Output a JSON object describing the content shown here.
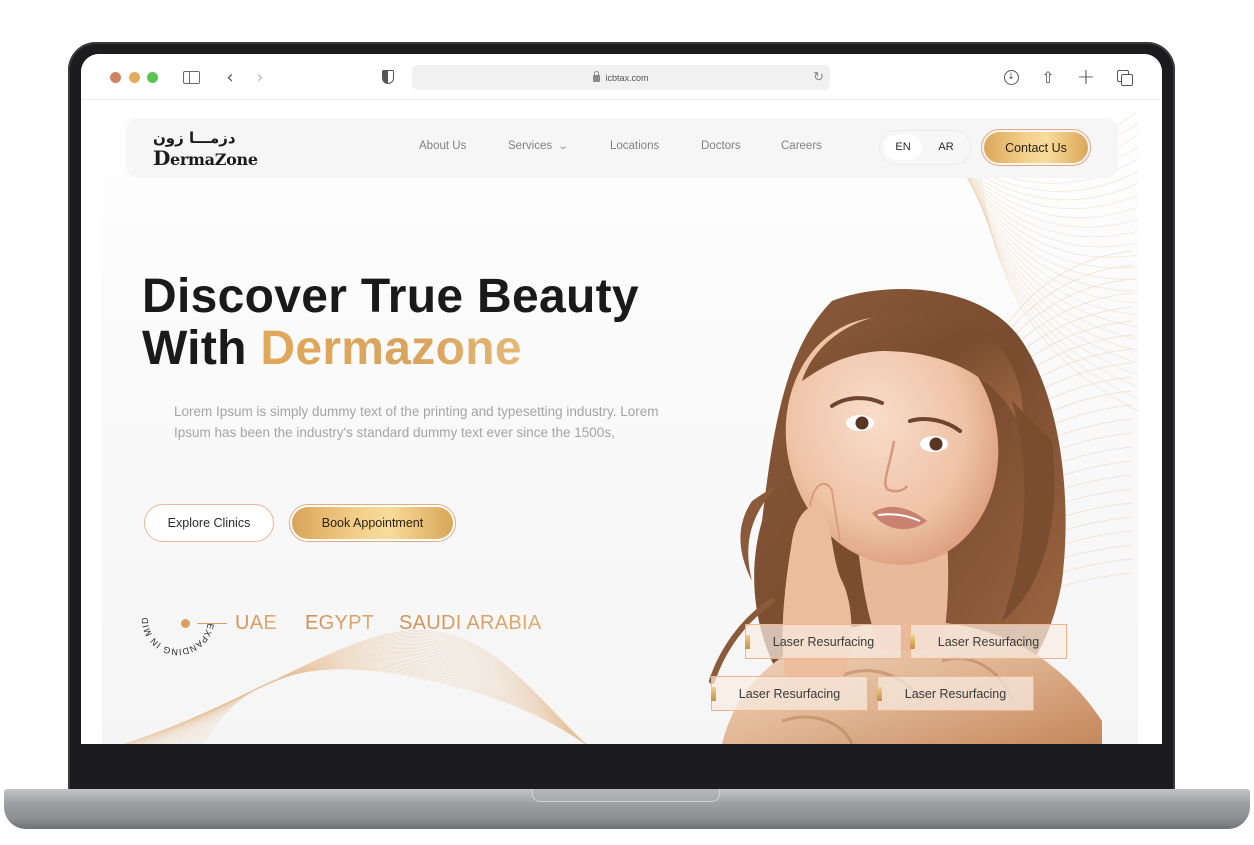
{
  "browser": {
    "url": "icbtax.com",
    "icons": {
      "sidebar": "sidebar-toggle-icon",
      "back": "chevron-left-icon",
      "forward": "chevron-right-icon",
      "privacy": "shield-icon",
      "lock": "lock-icon",
      "reload": "reload-icon",
      "downloads": "download-icon",
      "share": "share-icon",
      "new_tab": "plus-icon",
      "tabs": "tab-overview-icon"
    },
    "glyphs": {
      "back": "‹",
      "forward": "›",
      "reload": "↻",
      "download": "↓",
      "share": "⇧",
      "plus": "+"
    }
  },
  "site": {
    "logo": {
      "arabic": "دزمـــا زون",
      "english_initial": "D",
      "english_rest": "ermaZone"
    },
    "nav": {
      "items": [
        {
          "label": "About Us"
        },
        {
          "label": "Services",
          "has_dropdown": true
        },
        {
          "label": "Locations"
        },
        {
          "label": "Doctors"
        },
        {
          "label": "Careers"
        }
      ],
      "dropdown_glyph": "⌄"
    },
    "language": {
      "options": [
        "EN",
        "AR"
      ],
      "selected": "EN"
    },
    "contact_label": "Contact Us"
  },
  "hero": {
    "title_line1": "Discover True Beauty",
    "title_line2_prefix": "With ",
    "title_line2_accent": "Dermazone",
    "description": "Lorem Ipsum is simply dummy text of the printing and typesetting industry. Lorem Ipsum has been the industry's standard dummy text ever since the 1500s,",
    "buttons": {
      "explore": "Explore Clinics",
      "book": "Book Appointment"
    },
    "expanding_badge": "EXPANDING IN MIDDLE EAST",
    "countries": [
      "UAE",
      "EGYPT",
      "SAUDI ARABIA"
    ],
    "service_tags": [
      "Laser Resurfacing",
      "Laser Resurfacing",
      "Laser Resurfacing",
      "Laser Resurfacing"
    ]
  },
  "colors": {
    "accent_gold": "#d9a45e",
    "button_border": "#e8a884",
    "title_dark": "#1a1a1a",
    "body_grey": "#a4a4a4"
  }
}
